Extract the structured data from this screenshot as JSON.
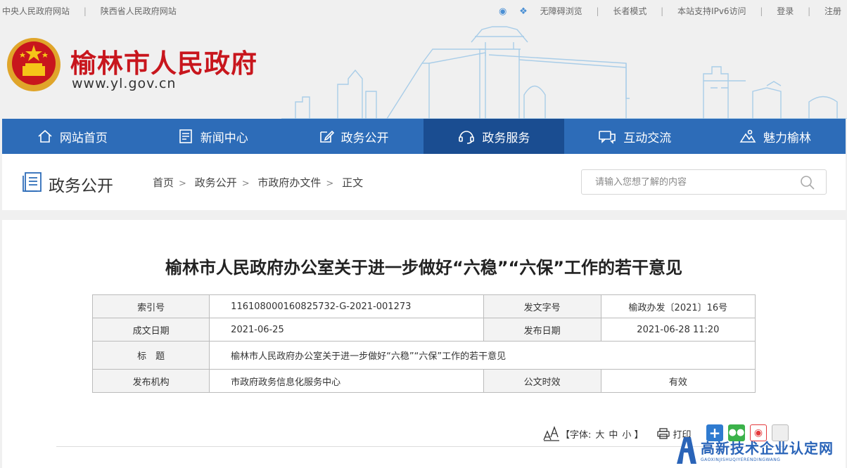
{
  "topbar": {
    "left_links": [
      "中央人民政府网站",
      "陕西省人民政府网站"
    ],
    "right_links": [
      "无障碍浏览",
      "长者模式",
      "本站支持IPv6访问",
      "登录",
      "注册"
    ]
  },
  "header": {
    "title": "榆林市人民政府",
    "url": "www.yl.gov.cn"
  },
  "nav": {
    "items": [
      {
        "label": "网站首页",
        "icon": "home-icon"
      },
      {
        "label": "新闻中心",
        "icon": "news-icon"
      },
      {
        "label": "政务公开",
        "icon": "edit-icon"
      },
      {
        "label": "政务服务",
        "icon": "headset-icon"
      },
      {
        "label": "互动交流",
        "icon": "chat-icon"
      },
      {
        "label": "魅力榆林",
        "icon": "mountain-icon"
      }
    ],
    "active_index": 3
  },
  "section": {
    "title": "政务公开",
    "breadcrumb": [
      "首页",
      "政务公开",
      "市政府办文件",
      "正文"
    ],
    "search_placeholder": "请输入您想了解的内容"
  },
  "article": {
    "title": "榆林市人民政府办公室关于进一步做好“六稳”“六保”工作的若干意见",
    "meta": {
      "index_label": "索引号",
      "index_value": "116108000160825732-G-2021-001273",
      "doc_no_label": "发文字号",
      "doc_no_value": "榆政办发〔2021〕16号",
      "date_label": "成文日期",
      "date_value": "2021-06-25",
      "pub_date_label": "发布日期",
      "pub_date_value": "2021-06-28 11:20",
      "subject_label": "标　题",
      "subject_value": "榆林市人民政府办公室关于进一步做好“六稳”“六保”工作的若干意见",
      "org_label": "发布机构",
      "org_value": "市政府政务信息化服务中心",
      "validity_label": "公文时效",
      "validity_value": "有效"
    },
    "tools": {
      "font_label": "【字体:",
      "font_sizes": [
        "大",
        "中",
        "小"
      ],
      "font_close": "】",
      "print_label": "打印"
    }
  },
  "watermark": {
    "title": "高新技术企业认定网",
    "subtitle": "GAOXINJISHUQIYERENDINGWANG"
  },
  "colors": {
    "brand_red": "#c8161d",
    "nav_blue": "#2d6cb8",
    "nav_active": "#1a4d91"
  }
}
